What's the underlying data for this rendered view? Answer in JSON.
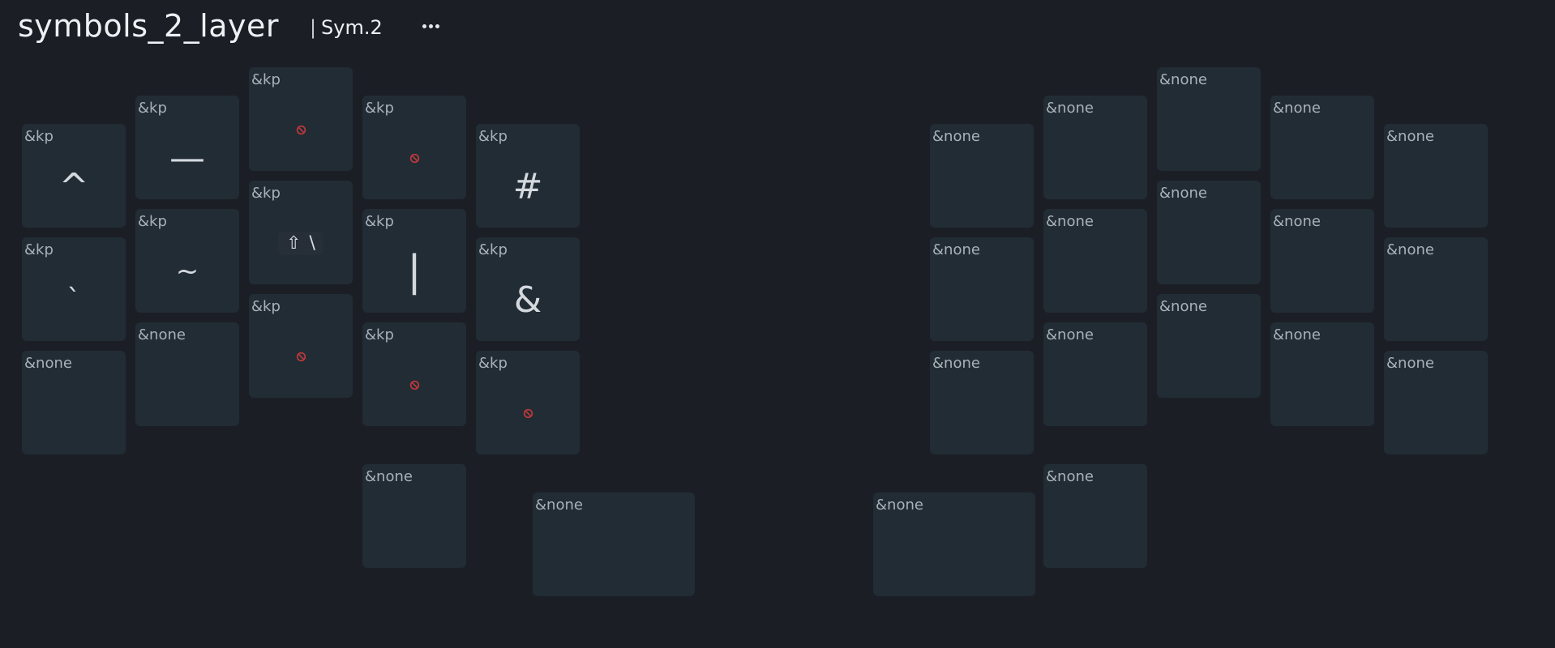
{
  "header": {
    "layer_name": "symbols_2_layer",
    "separator": "|",
    "layer_label": "Sym.2",
    "menu_icon": "more-horizontal-icon"
  },
  "colors": {
    "background": "#1b1f25",
    "key_background": "#222c35",
    "none_icon": "#c0393b"
  },
  "keys": [
    {
      "id": "L0",
      "behavior": "&kp",
      "param": "^"
    },
    {
      "id": "L1",
      "behavior": "&kp",
      "param": "—"
    },
    {
      "id": "L2",
      "behavior": "&kp",
      "param_icon": "none-icon"
    },
    {
      "id": "L3",
      "behavior": "&kp",
      "param_icon": "none-icon"
    },
    {
      "id": "L4",
      "behavior": "&kp",
      "param": "#"
    },
    {
      "id": "R0",
      "behavior": "&none"
    },
    {
      "id": "R1",
      "behavior": "&none"
    },
    {
      "id": "R2",
      "behavior": "&none"
    },
    {
      "id": "R3",
      "behavior": "&none"
    },
    {
      "id": "R4",
      "behavior": "&none"
    },
    {
      "id": "L5",
      "behavior": "&kp",
      "param": "`"
    },
    {
      "id": "L6",
      "behavior": "&kp",
      "param": "~"
    },
    {
      "id": "L7",
      "behavior": "&kp",
      "param_chip": {
        "modifier_icon": "shift-icon",
        "modifier": "⇧",
        "key": "\\"
      }
    },
    {
      "id": "L8",
      "behavior": "&kp",
      "param": "|"
    },
    {
      "id": "L9",
      "behavior": "&kp",
      "param": "&"
    },
    {
      "id": "R5",
      "behavior": "&none"
    },
    {
      "id": "R6",
      "behavior": "&none"
    },
    {
      "id": "R7",
      "behavior": "&none"
    },
    {
      "id": "R8",
      "behavior": "&none"
    },
    {
      "id": "R9",
      "behavior": "&none"
    },
    {
      "id": "L10",
      "behavior": "&none"
    },
    {
      "id": "L11",
      "behavior": "&none"
    },
    {
      "id": "L12",
      "behavior": "&kp",
      "param_icon": "none-icon"
    },
    {
      "id": "L13",
      "behavior": "&kp",
      "param_icon": "none-icon"
    },
    {
      "id": "L14",
      "behavior": "&kp",
      "param_icon": "none-icon"
    },
    {
      "id": "R10",
      "behavior": "&none"
    },
    {
      "id": "R11",
      "behavior": "&none"
    },
    {
      "id": "R12",
      "behavior": "&none"
    },
    {
      "id": "R13",
      "behavior": "&none"
    },
    {
      "id": "R14",
      "behavior": "&none"
    },
    {
      "id": "T0",
      "behavior": "&none"
    },
    {
      "id": "T1",
      "behavior": "&none"
    },
    {
      "id": "T2",
      "behavior": "&none"
    },
    {
      "id": "T3",
      "behavior": "&none"
    }
  ]
}
